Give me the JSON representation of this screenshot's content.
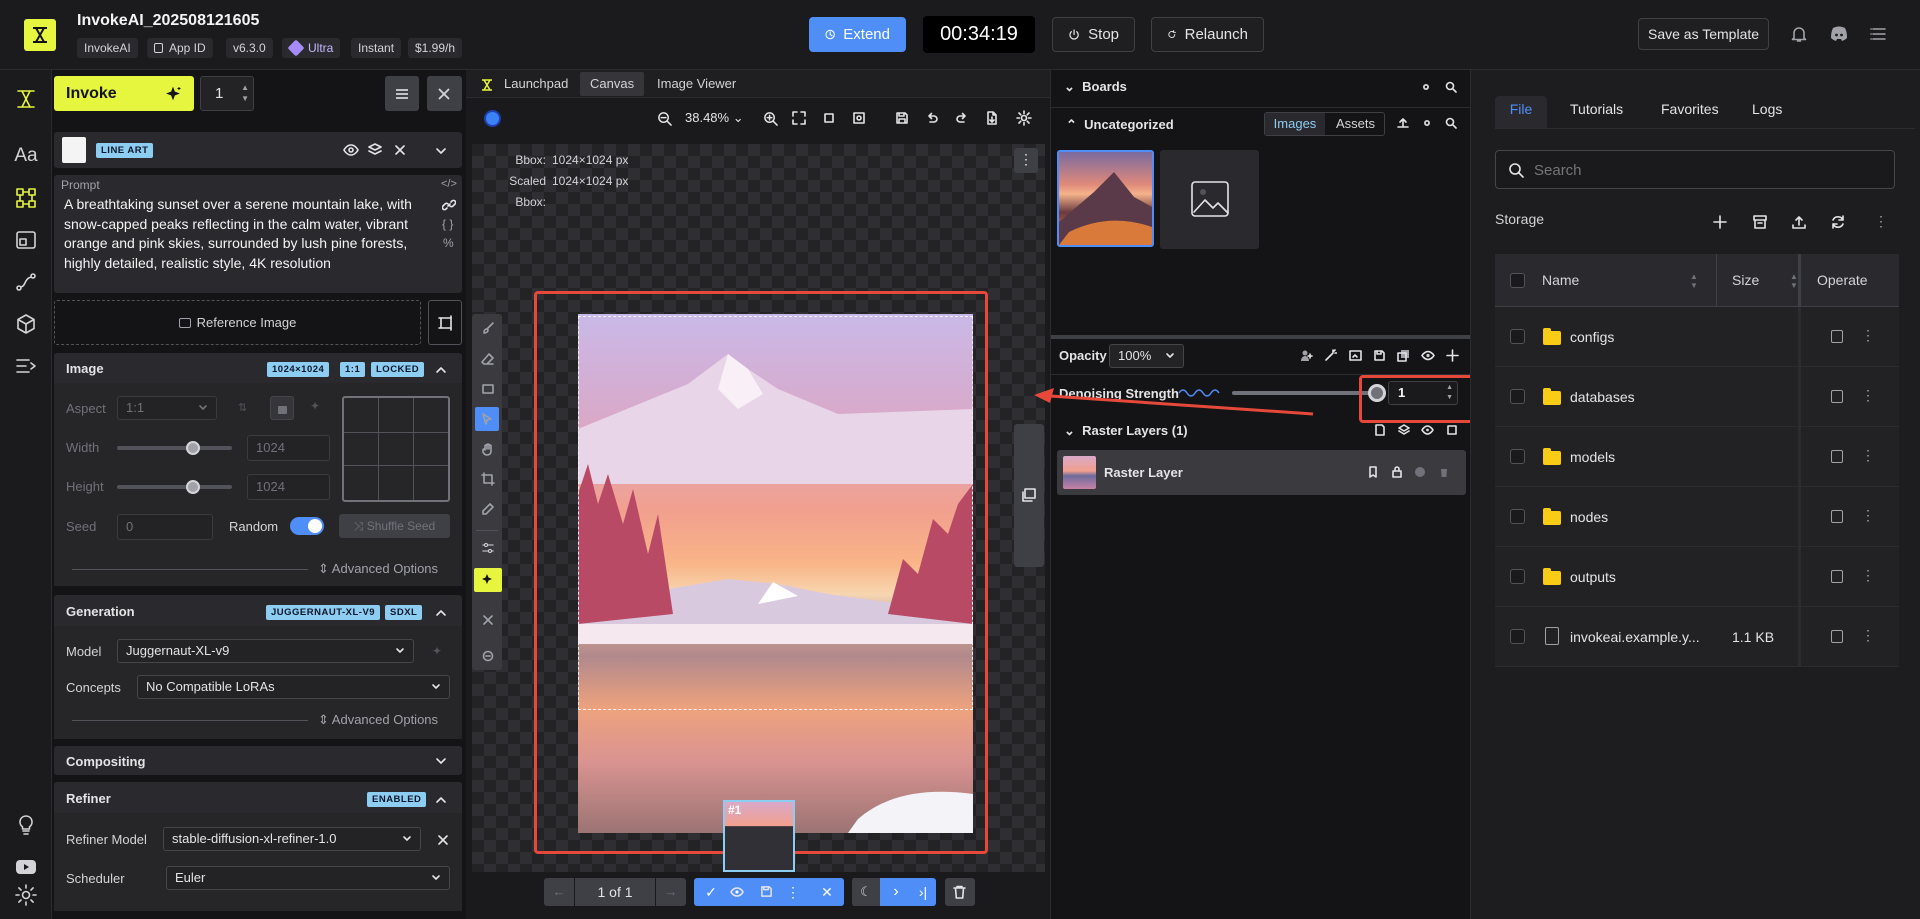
{
  "header": {
    "title": "InvokeAI_202508121605",
    "chips": [
      "InvokeAI",
      "App ID",
      "v6.3.0",
      "Ultra",
      "Instant",
      "$1.99/h"
    ],
    "extend": "Extend",
    "timer": "00:34:19",
    "stop": "Stop",
    "relaunch": "Relaunch",
    "save_template": "Save as Template"
  },
  "left": {
    "invoke": "Invoke",
    "count": "1",
    "lineart_badge": "LINE ART",
    "prompt_label": "Prompt",
    "prompt_text": "A breathtaking sunset over a serene mountain lake, with snow-capped peaks reflecting in the calm water, vibrant orange and pink skies, surrounded by lush pine forests, highly detailed, realistic style, 4K resolution",
    "reference_image": "Reference Image",
    "image": {
      "title": "Image",
      "badges": [
        "1024×1024",
        "1:1",
        "LOCKED"
      ],
      "aspect_label": "Aspect",
      "aspect_value": "1:1",
      "width_label": "Width",
      "width_value": "1024",
      "height_label": "Height",
      "height_value": "1024",
      "width_fraction": 0.66,
      "height_fraction": 0.66,
      "seed_label": "Seed",
      "seed_value": "0",
      "random_label": "Random",
      "shuffle": "Shuffle Seed",
      "advanced": "Advanced Options"
    },
    "generation": {
      "title": "Generation",
      "badges": [
        "JUGGERNAUT-XL-V9",
        "SDXL"
      ],
      "model_label": "Model",
      "model_value": "Juggernaut-XL-v9",
      "concepts_label": "Concepts",
      "concepts_value": "No Compatible LoRAs",
      "advanced": "Advanced Options"
    },
    "compositing": {
      "title": "Compositing"
    },
    "refiner": {
      "title": "Refiner",
      "badge": "ENABLED",
      "model_label": "Refiner Model",
      "model_value": "stable-diffusion-xl-refiner-1.0",
      "scheduler_label": "Scheduler",
      "scheduler_value": "Euler"
    }
  },
  "center": {
    "tabs": [
      "Launchpad",
      "Canvas",
      "Image Viewer"
    ],
    "zoom": "38.48%",
    "bbox_label": "Bbox:",
    "bbox_value": "1024×1024 px",
    "scaled_label": "Scaled Bbox:",
    "scaled_value": "1024×1024 px",
    "staging_thumb": "#1",
    "pager": "1 of 1"
  },
  "boards": {
    "title": "Boards",
    "uncategorized": "Uncategorized",
    "images_tab": "Images",
    "assets_tab": "Assets",
    "opacity_label": "Opacity",
    "opacity_value": "100%",
    "denoise_label": "Denoising Strength",
    "denoise_value": "1",
    "denoise_fraction": 1,
    "raster_header": "Raster Layers (1)",
    "raster_layer": "Raster Layer"
  },
  "files": {
    "tabs": [
      "File",
      "Tutorials",
      "Favorites",
      "Logs"
    ],
    "search_placeholder": "Search",
    "storage": "Storage",
    "columns": [
      "Name",
      "Size",
      "Operate"
    ],
    "rows": [
      {
        "name": "configs",
        "size": "",
        "type": "folder"
      },
      {
        "name": "databases",
        "size": "",
        "type": "folder"
      },
      {
        "name": "models",
        "size": "",
        "type": "folder"
      },
      {
        "name": "nodes",
        "size": "",
        "type": "folder"
      },
      {
        "name": "outputs",
        "size": "",
        "type": "folder"
      },
      {
        "name": "invokeai.example.y...",
        "size": "1.1 KB",
        "type": "file"
      }
    ]
  },
  "colors": {
    "accent": "#4f8ef7",
    "invoke": "#e6f53d",
    "highlight": "#e6493a",
    "badge": "#8ecdf2"
  }
}
